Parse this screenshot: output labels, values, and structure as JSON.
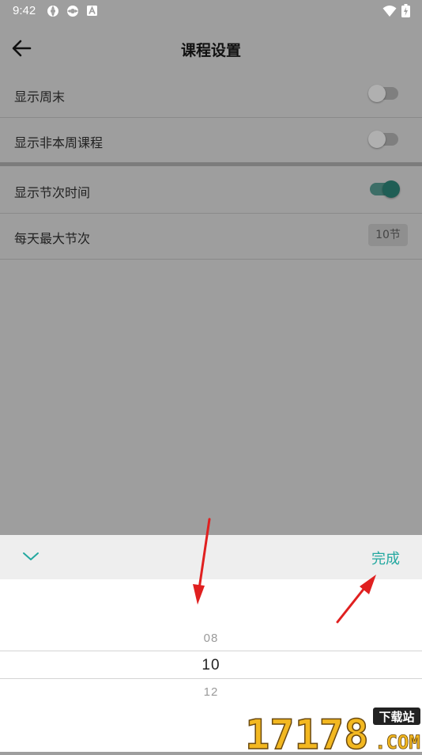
{
  "status_bar": {
    "time": "9:42",
    "icons": [
      "sync-icon",
      "sync-icon",
      "font-icon",
      "wifi-icon",
      "battery-icon"
    ]
  },
  "app_bar": {
    "title": "课程设置",
    "back_icon": "arrow-left-icon"
  },
  "settings": {
    "rows": [
      {
        "label": "显示周末",
        "control": "switch",
        "on": false
      },
      {
        "label": "显示非本周课程",
        "control": "switch",
        "on": false
      },
      {
        "label": "显示节次时间",
        "control": "switch",
        "on": true
      },
      {
        "label": "每天最大节次",
        "control": "value",
        "value": "10节"
      }
    ]
  },
  "picker": {
    "collapse_icon": "chevron-down-icon",
    "done_label": "完成",
    "options": [
      "08",
      "10",
      "12"
    ],
    "selected": "10"
  },
  "colors": {
    "accent": "#23a8a0",
    "overlay": "#9e9e9e",
    "annotation": "#e02020"
  },
  "watermark": {
    "number": "17178",
    "tag": "下载站",
    "domain": ".COM"
  }
}
